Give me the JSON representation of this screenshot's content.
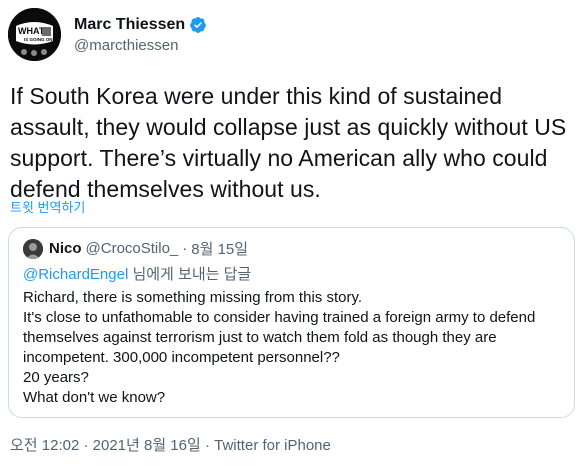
{
  "author": {
    "display_name": "Marc Thiessen",
    "handle": "@marcthiessen",
    "avatar_text_lines": [
      "WHAT",
      "IS GOING ON?"
    ],
    "verified_icon": "verified-badge-icon",
    "accent_color": "#1d9bf0"
  },
  "tweet": {
    "text": "If South Korea were under this kind of sustained assault, they would collapse just as quickly without US support. There’s virtually no American ally who could defend themselves without us.",
    "translate_label": "트윗 번역하기"
  },
  "quoted": {
    "display_name": "Nico",
    "handle": "@CrocoStilo_",
    "separator": "·",
    "date": "8월 15일",
    "reply_mention": "@RichardEngel",
    "reply_suffix": " 님에게 보내는 답글",
    "lines": [
      "Richard, there is something missing from this story.",
      "It's close to unfathomable to consider having trained a foreign army to defend",
      "themselves against terrorism just to watch them fold as though they are",
      "incompetent. 300,000 incompetent personnel??",
      "20 years?",
      "What don't we know?"
    ]
  },
  "meta": {
    "time": "오전 12:02",
    "sep1": " · ",
    "date": "2021년 8월 16일",
    "sep2": " · ",
    "source": "Twitter for iPhone"
  }
}
